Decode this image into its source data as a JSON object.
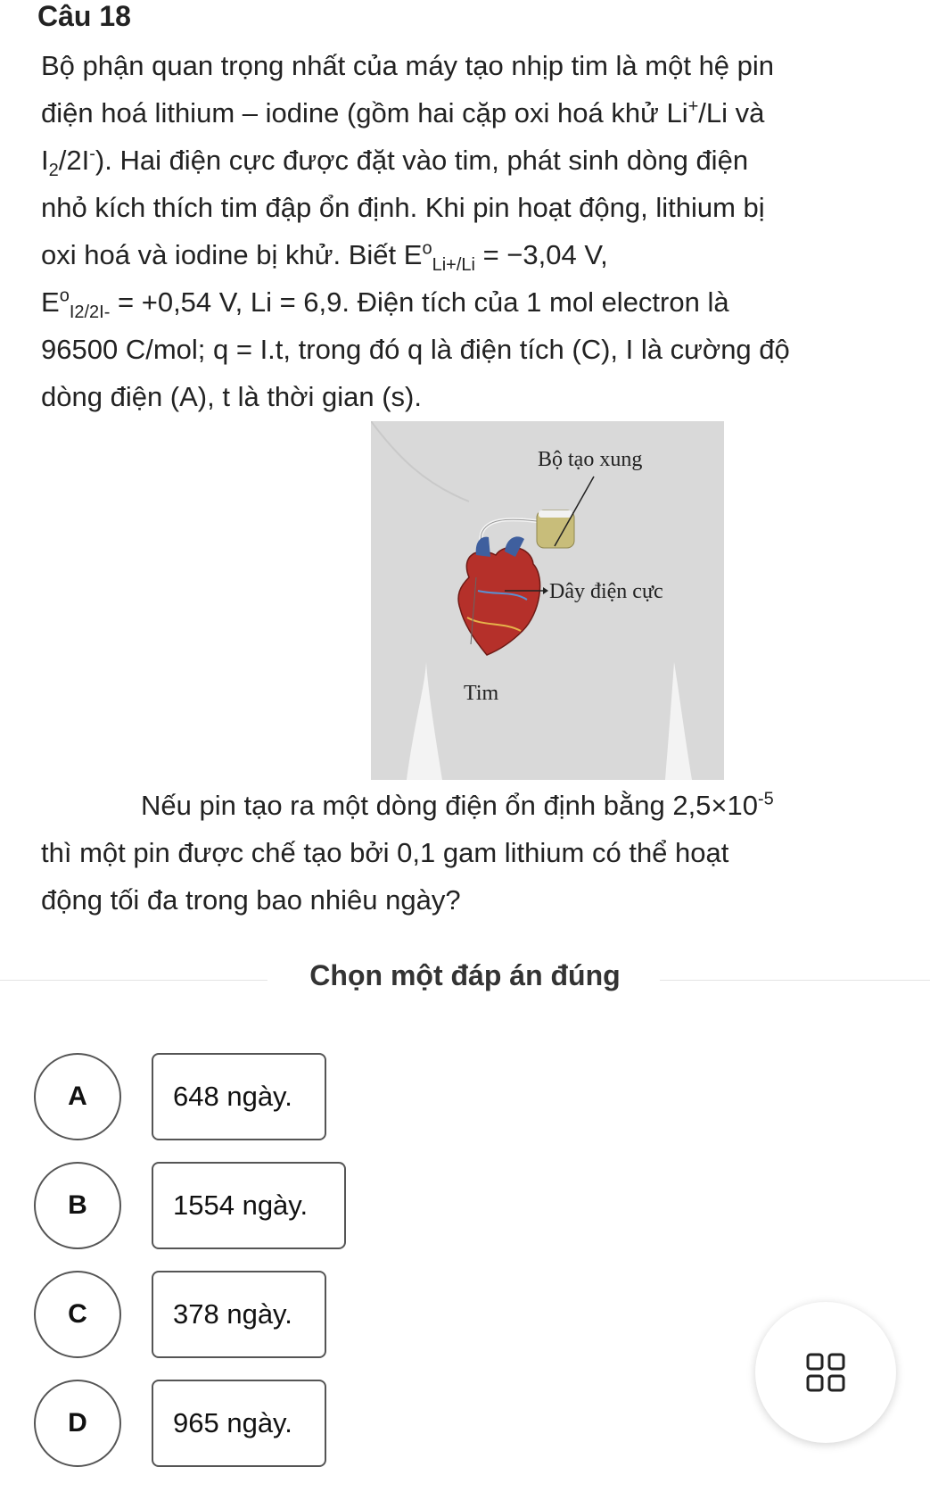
{
  "question": {
    "title": "Câu 18",
    "lines": {
      "l1": "Bộ phận quan trọng nhất của máy tạo nhịp tim là một hệ pin",
      "l2a": "điện hoá lithium – iodine (gồm hai cặp oxi hoá khử Li",
      "l2sup": "+",
      "l2b": "/Li và",
      "l3a": "I",
      "l3sub": "2",
      "l3b": "/2I",
      "l3sup": "-",
      "l3c": "). Hai điện cực được đặt vào tim, phát sinh dòng điện",
      "l4": "nhỏ kích thích tim đập ổn định. Khi pin hoạt động, lithium bị",
      "l5a": "oxi hoá và iodine bị khử. Biết E",
      "l5sup": "o",
      "l5sub": "Li+/Li",
      "l5b": " = −3,04 V,",
      "l6a": "E",
      "l6sup": "o",
      "l6sub": "I2/2I-",
      "l6b": " = +0,54 V, Li = 6,9. Điện tích của 1 mol electron là",
      "l7": "96500 C/mol; q = I.t, trong đó q là điện tích (C), I là cường độ",
      "l8": "dòng điện (A), t là thời gian (s)."
    },
    "after": {
      "l1a": "Nếu pin tạo ra một dòng điện ổn định bằng 2,5×10",
      "l1sup": "-5",
      "l2": "thì một pin được chế tạo bởi 0,1 gam lithium có thể hoạt",
      "l3": "động tối đa trong bao nhiêu ngày?"
    }
  },
  "figure": {
    "label_pulse_generator": "Bộ tạo xung",
    "label_electrode_wire": "Dây điện cực",
    "label_heart": "Tim"
  },
  "choose_label": "Chọn một đáp án đúng",
  "options": [
    {
      "letter": "A",
      "text": "648 ngày."
    },
    {
      "letter": "B",
      "text": "1554 ngày."
    },
    {
      "letter": "C",
      "text": "378 ngày."
    },
    {
      "letter": "D",
      "text": "965 ngày."
    }
  ],
  "icons": {
    "grid_button": "grid-icon"
  },
  "colors": {
    "figure_bg": "#d9d9d9",
    "heart": "#b5302a",
    "generator": "#c8bd7a"
  }
}
